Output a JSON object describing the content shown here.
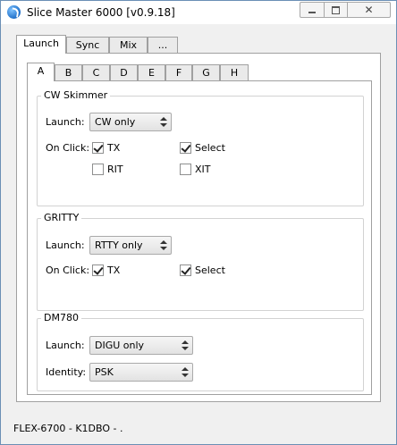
{
  "window": {
    "title": "Slice Master 6000 [v0.9.18]"
  },
  "main_tabs": [
    {
      "label": "Launch",
      "active": true
    },
    {
      "label": "Sync",
      "active": false
    },
    {
      "label": "Mix",
      "active": false
    },
    {
      "label": "...",
      "active": false
    }
  ],
  "slice_tabs": [
    {
      "label": "A",
      "active": true
    },
    {
      "label": "B",
      "active": false
    },
    {
      "label": "C",
      "active": false
    },
    {
      "label": "D",
      "active": false
    },
    {
      "label": "E",
      "active": false
    },
    {
      "label": "F",
      "active": false
    },
    {
      "label": "G",
      "active": false
    },
    {
      "label": "H",
      "active": false
    }
  ],
  "groups": {
    "cw_skimmer": {
      "title": "CW Skimmer",
      "launch_label": "Launch:",
      "launch_value": "CW only",
      "onclick_label": "On Click:",
      "tx": {
        "label": "TX",
        "checked": true
      },
      "select": {
        "label": "Select",
        "checked": true
      },
      "rit": {
        "label": "RIT",
        "checked": false
      },
      "xit": {
        "label": "XIT",
        "checked": false
      }
    },
    "gritty": {
      "title": "GRITTY",
      "launch_label": "Launch:",
      "launch_value": "RTTY only",
      "onclick_label": "On Click:",
      "tx": {
        "label": "TX",
        "checked": true
      },
      "select": {
        "label": "Select",
        "checked": true
      }
    },
    "dm780": {
      "title": "DM780",
      "launch_label": "Launch:",
      "launch_value": "DIGU only",
      "identity_label": "Identity:",
      "identity_value": "PSK"
    }
  },
  "status_bar": {
    "text": "FLEX-6700 - K1DBO - ."
  }
}
